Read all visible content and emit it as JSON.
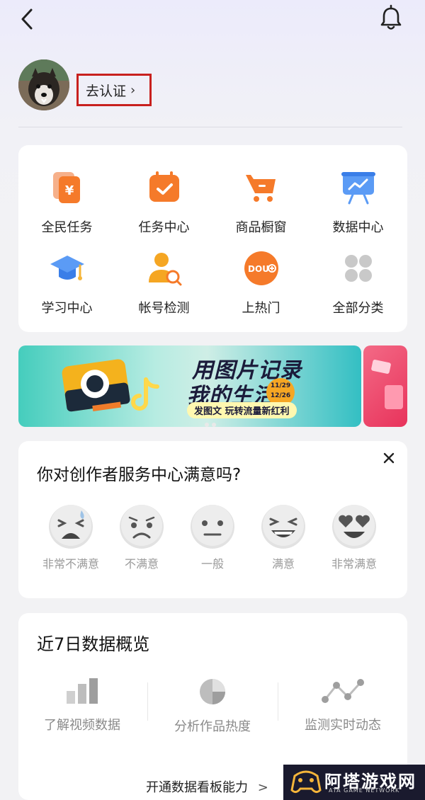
{
  "profile": {
    "verify_label": "去认证",
    "verify_chevron": "›"
  },
  "tools": [
    {
      "label": "全民任务",
      "icon": "yuan-cards-icon"
    },
    {
      "label": "任务中心",
      "icon": "calendar-check-icon"
    },
    {
      "label": "商品橱窗",
      "icon": "shopping-cart-icon"
    },
    {
      "label": "数据中心",
      "icon": "presentation-board-icon"
    },
    {
      "label": "学习中心",
      "icon": "graduation-cap-icon"
    },
    {
      "label": "帐号检测",
      "icon": "user-search-icon"
    },
    {
      "label": "上热门",
      "icon": "dou-plus-icon"
    },
    {
      "label": "全部分类",
      "icon": "grid-dots-icon"
    }
  ],
  "banner": {
    "title_line1": "用图片记录",
    "title_line2": "我的生活",
    "subtitle": "发图文 玩转流量新红利",
    "date_badge_top": "11/29",
    "date_badge_bottom": "12/26"
  },
  "survey": {
    "title": "你对创作者服务中心满意吗?",
    "options": [
      "非常不满意",
      "不满意",
      "一般",
      "满意",
      "非常满意"
    ]
  },
  "stats": {
    "title": "近7日数据概览",
    "items": [
      {
        "label": "了解视频数据",
        "icon": "bar-chart-icon"
      },
      {
        "label": "分析作品热度",
        "icon": "pie-chart-icon"
      },
      {
        "label": "监测实时动态",
        "icon": "line-trend-icon"
      }
    ],
    "open_link": "开通数据看板能力",
    "open_chevron": ">"
  },
  "watermark": {
    "name": "阿塔游戏网",
    "sub": "ATA GAME NETWORK"
  },
  "colors": {
    "accent_orange": "#f57a2a",
    "highlight_red": "#c8201e",
    "gray_icon": "#b8b8b8"
  }
}
